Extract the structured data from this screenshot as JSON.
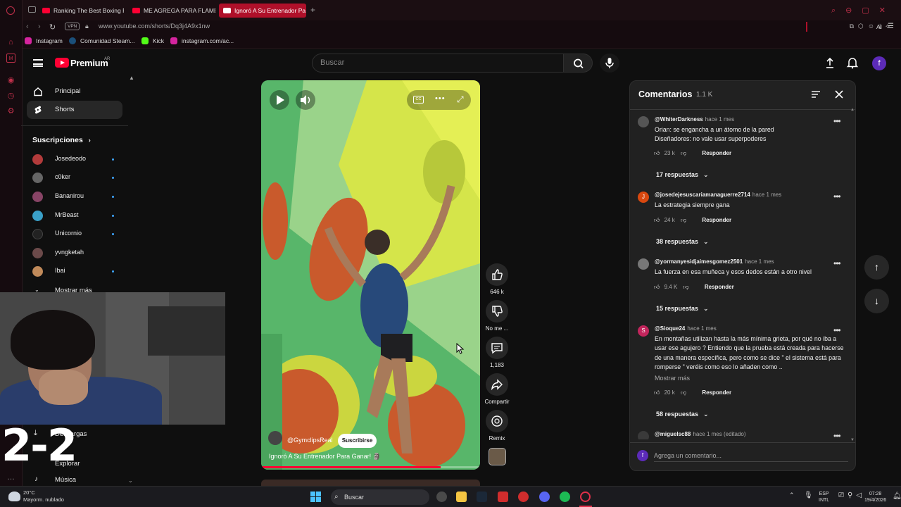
{
  "browser": {
    "tabs": [
      {
        "label": "Ranking The Best Boxing R"
      },
      {
        "label": "ME AGREGA PARA FLAME"
      },
      {
        "label": "Ignoró A Su Entrenador Pa"
      }
    ],
    "vpn_label": "VPN",
    "url": "www.youtube.com/shorts/Dq3j4A9x1nw",
    "ai_label": "AI",
    "bookmarks": [
      {
        "label": "Instagram"
      },
      {
        "label": "Comunidad Steam..."
      },
      {
        "label": "Kick"
      },
      {
        "label": "instagram.com/ac..."
      }
    ]
  },
  "header": {
    "logo": "Premium",
    "logo_region": "AR",
    "search_placeholder": "Buscar",
    "avatar_letter": "f"
  },
  "sidebar": {
    "items": [
      {
        "label": "Principal"
      },
      {
        "label": "Shorts"
      }
    ],
    "subs_heading": "Suscripciones",
    "subscriptions": [
      {
        "name": "Josedeodo",
        "color": "#b23b3b"
      },
      {
        "name": "c0ker",
        "color": "#666666"
      },
      {
        "name": "Bananirou",
        "color": "#884466"
      },
      {
        "name": "MrBeast",
        "color": "#3aa0c8"
      },
      {
        "name": "Unicornio",
        "color": "#222222"
      },
      {
        "name": "yvngketah",
        "color": "#6b4a4a"
      },
      {
        "name": "Ibai",
        "color": "#c08a5a"
      }
    ],
    "show_more": "Mostrar más",
    "downloads": "Descargas",
    "explore": "Explorar",
    "music": "Música"
  },
  "overlay": {
    "score": "2-2"
  },
  "video": {
    "channel": "@GymclipsReal",
    "subscribe": "Suscribirse",
    "title": "Ignoró A Su Entrenador Para Ganar! 🗿",
    "progress": 0.82
  },
  "actions": {
    "likes": "646 k",
    "dislike": "No me ...",
    "comments": "1,183",
    "share": "Compartir",
    "remix": "Remix"
  },
  "comments": {
    "title": "Comentarios",
    "count": "1.1 K",
    "add_placeholder": "Agrega un comentario...",
    "more_label": "Mostrar más",
    "reply_label": "Responder",
    "items": [
      {
        "user": "@WhiterDarkness",
        "time": "hace 1 mes",
        "avatar_color": "#555555",
        "avatar_letter": "",
        "text": "Orian: se engancha a un átomo de la pared\nDiseñadores: no vale usar superpoderes",
        "likes": "23 k",
        "replies": "17 respuestas"
      },
      {
        "user": "@josedejesuscariamanaguerre2714",
        "time": "hace 1 mes",
        "avatar_color": "#d9480f",
        "avatar_letter": "J",
        "text": "La estrategia siempre gana",
        "likes": "24 k",
        "replies": "38 respuestas"
      },
      {
        "user": "@yormanyesidjaimesgomez2501",
        "time": "hace 1 mes",
        "avatar_color": "#777777",
        "avatar_letter": "",
        "text": "La fuerza en esa muñeca y esos dedos están a otro nivel",
        "likes": "9.4 K",
        "replies": "15 respuestas"
      },
      {
        "user": "@Sioque24",
        "time": "hace 1 mes",
        "avatar_color": "#c2255c",
        "avatar_letter": "S",
        "text": "En montañas utilizan hasta la más mínima grieta, por qué no iba a usar ese agujero ? Entiendo que la prueba está creada para hacerse de una manera específica, pero como se dice \" el sistema está para romperse \" veréis como eso lo añaden como ..",
        "likes": "20 k",
        "replies": "58 respuestas"
      },
      {
        "user": "@miguelsc88",
        "time": "hace 1 mes (editado)",
        "avatar_color": "#3a3a3a",
        "avatar_letter": "",
        "text": "",
        "likes": "",
        "replies": ""
      }
    ]
  },
  "taskbar": {
    "temp": "20°C",
    "weather": "Mayorm. nublado",
    "search": "Buscar",
    "lang_top": "ESP",
    "lang_bottom": "INTL",
    "time": "07:28",
    "date": "19/4/2026"
  },
  "colors": {
    "yt_red": "#ff0033",
    "browser_accent": "#b0102a",
    "panel_bg": "#212121"
  }
}
